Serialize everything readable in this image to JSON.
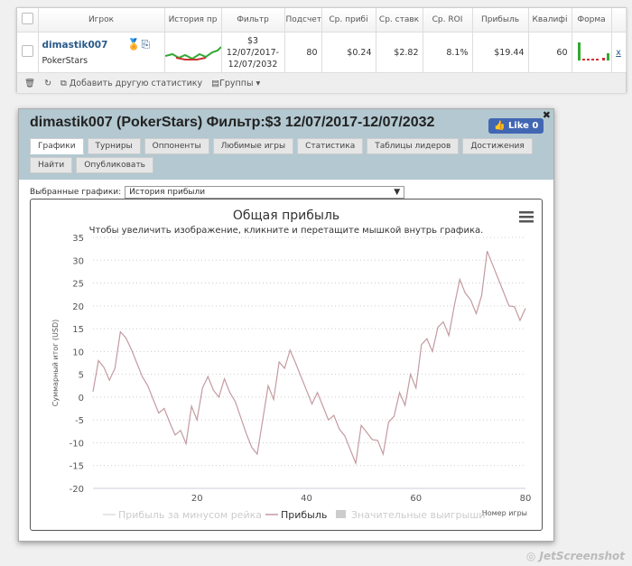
{
  "table": {
    "headers": [
      "Игрок",
      "История пр",
      "Фильтр",
      "Подсчет",
      "Ср. прибі",
      "Ср. ставк",
      "Ср. ROI",
      "Прибыль",
      "Квалифі",
      "Форма"
    ],
    "row": {
      "player": "dimastik007",
      "network": "PokerStars",
      "filter": [
        "$3",
        "12/07/2017-",
        "12/07/2032"
      ],
      "count": "80",
      "avg_profit": "$0.24",
      "avg_stake": "$2.82",
      "roi": "8.1%",
      "profit": "$19.44",
      "qual": "60",
      "remove": "x"
    }
  },
  "footer": {
    "add_stat": "Добавить другую статистику",
    "groups": "Группы"
  },
  "modal": {
    "title": "dimastik007 (PokerStars) Фильтр:$3 12/07/2017-12/07/2032",
    "like": "Like 0",
    "close": "✖",
    "tabs": [
      "Графики",
      "Турниры",
      "Оппоненты",
      "Любимые игры",
      "Статистика",
      "Таблицы лидеров",
      "Достижения",
      "Найти",
      "Опубликовать"
    ],
    "select_label": "Выбранные графики:",
    "select_value": "История прибыли"
  },
  "chart_data": {
    "type": "line",
    "title": "Общая прибыль",
    "subtitle": "Чтобы увеличить изображение, кликните и перетащите мышкой внутрь графика.",
    "ylabel": "Суммарный итог (USD)",
    "xlabel": "Номер игры",
    "ylim": [
      -20,
      35
    ],
    "xlim": [
      1,
      80
    ],
    "yticks": [
      35,
      30,
      25,
      20,
      15,
      10,
      5,
      0,
      -5,
      -10,
      -15,
      -20
    ],
    "xticks": [
      20,
      40,
      60,
      80
    ],
    "grid": true,
    "line_color": "#c49aa0",
    "legend": [
      {
        "name": "Прибыль за минусом рейка",
        "color": "#dddddd",
        "active": false
      },
      {
        "name": "Прибыль",
        "color": "#c49aa0",
        "active": true
      },
      {
        "name": "Значительные выигрыши",
        "color": "#cccccc",
        "active": false
      }
    ],
    "legend_placement": "bottom",
    "series": [
      {
        "name": "Прибыль",
        "values": [
          1.2,
          8,
          6.5,
          3.7,
          6.3,
          14.3,
          13,
          10.5,
          7.5,
          4.5,
          2.5,
          -0.5,
          -3.5,
          -2.5,
          -5.5,
          -8.3,
          -7.3,
          -10.2,
          -2,
          -5,
          2,
          4.5,
          1.5,
          0,
          4,
          1,
          -1,
          -4.5,
          -8,
          -11,
          -12.5,
          -5,
          2.5,
          -0.5,
          7.7,
          6.3,
          10.3,
          7.5,
          4.5,
          1.5,
          -1.5,
          1,
          -2,
          -5,
          -4,
          -7,
          -8.5,
          -11.5,
          -14.5,
          -6.2,
          -7.7,
          -9.3,
          -9.5,
          -12.5,
          -5.5,
          -4.2,
          1,
          -1.8,
          5,
          2,
          11.5,
          12.8,
          10,
          15.3,
          16.5,
          13.5,
          20,
          25.8,
          22.8,
          21.3,
          18.3,
          22.3,
          32,
          29,
          26,
          23,
          20,
          19.8,
          16.8,
          19.44
        ]
      }
    ]
  },
  "watermark": "JetScreenshot"
}
